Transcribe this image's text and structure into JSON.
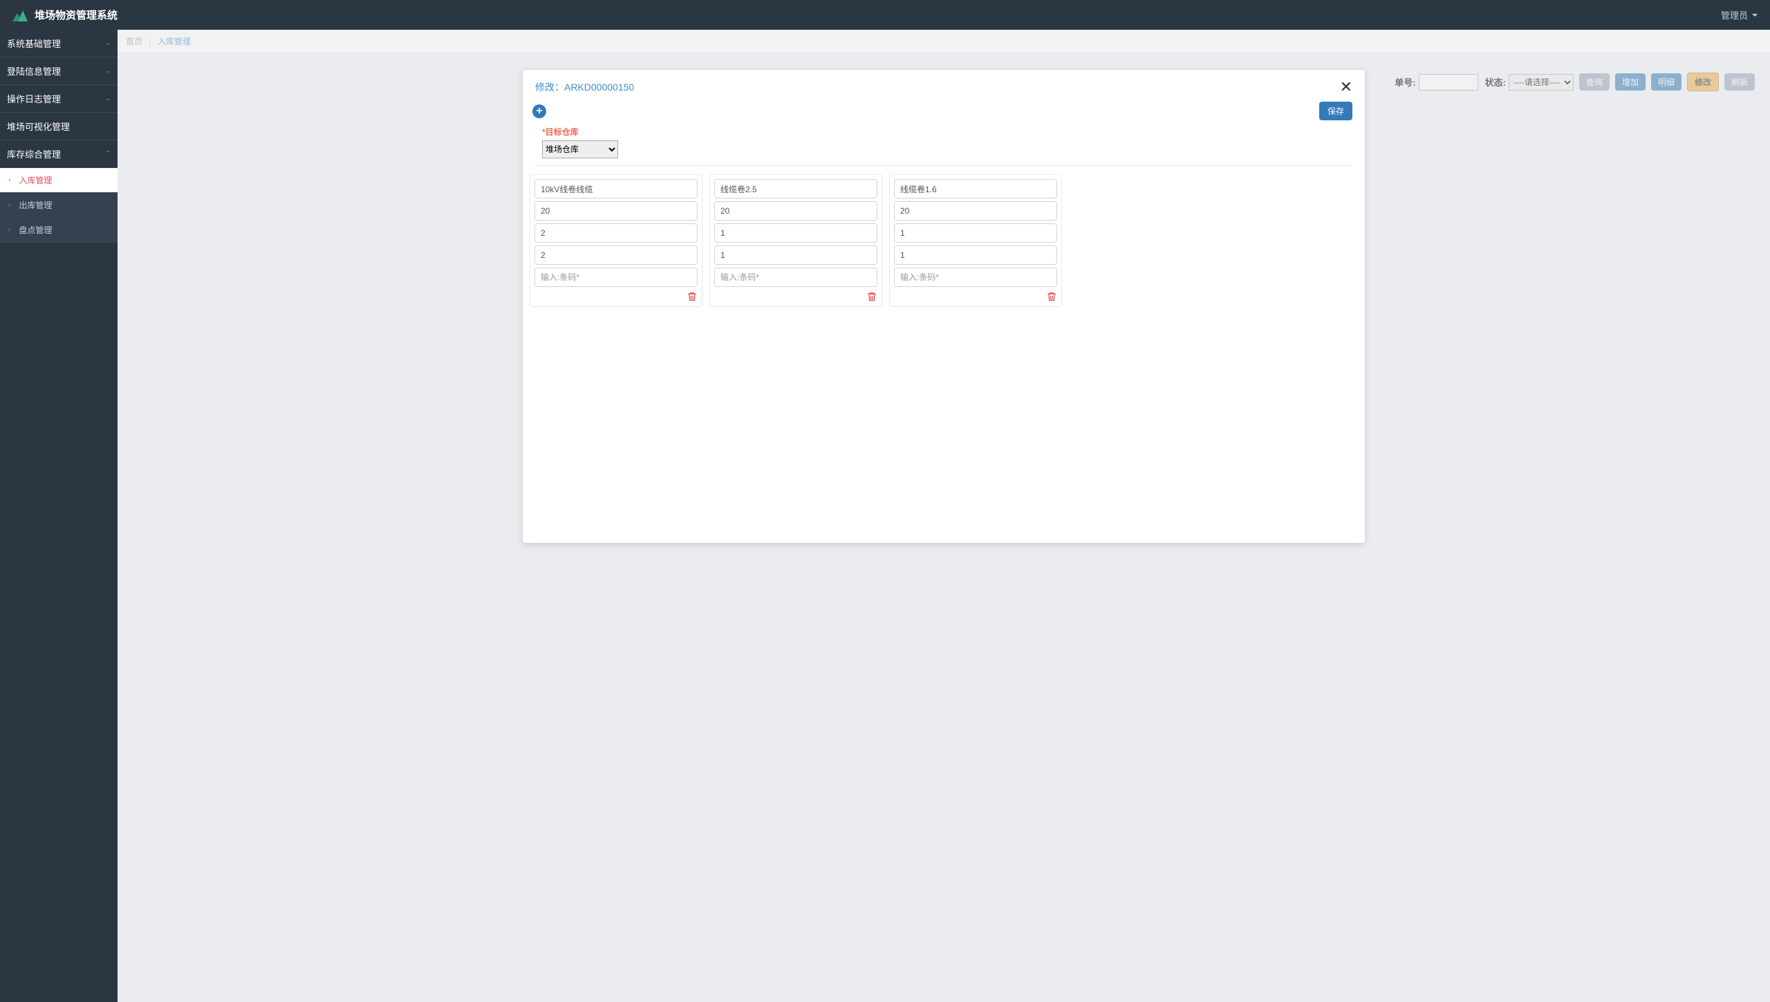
{
  "header": {
    "app_title": "堆场物资管理系统",
    "user_label": "管理员"
  },
  "sidebar": {
    "items": [
      {
        "label": "系统基础管理",
        "has_children": true
      },
      {
        "label": "登陆信息管理",
        "has_children": true
      },
      {
        "label": "操作日志管理",
        "has_children": true
      },
      {
        "label": "堆场可视化管理",
        "has_children": false
      },
      {
        "label": "库存综合管理",
        "has_children": true,
        "expanded": true
      }
    ],
    "sub_items": [
      {
        "label": "入库管理",
        "active": true
      },
      {
        "label": "出库管理",
        "active": false
      },
      {
        "label": "盘点管理",
        "active": false
      }
    ]
  },
  "breadcrumb": {
    "home": "首页",
    "current": "入库管理"
  },
  "toolbar": {
    "order_label": "单号:",
    "status_label": "状态:",
    "status_placeholder": "----请选择----",
    "query": "查询",
    "add": "增加",
    "detail": "明细",
    "edit": "修改",
    "refresh": "刷新"
  },
  "modal": {
    "title_prefix": "修改：",
    "record_id": "ARKD00000150",
    "save": "保存",
    "target_label": "*目标仓库",
    "target_value": "堆场仓库",
    "barcode_placeholder": "输入:条码*",
    "cards": [
      {
        "name": "10kV线卷线缆",
        "v1": "20",
        "v2": "2",
        "v3": "2"
      },
      {
        "name": "线缆卷2.5",
        "v1": "20",
        "v2": "1",
        "v3": "1"
      },
      {
        "name": "线缆卷1.6",
        "v1": "20",
        "v2": "1",
        "v3": "1"
      }
    ]
  }
}
